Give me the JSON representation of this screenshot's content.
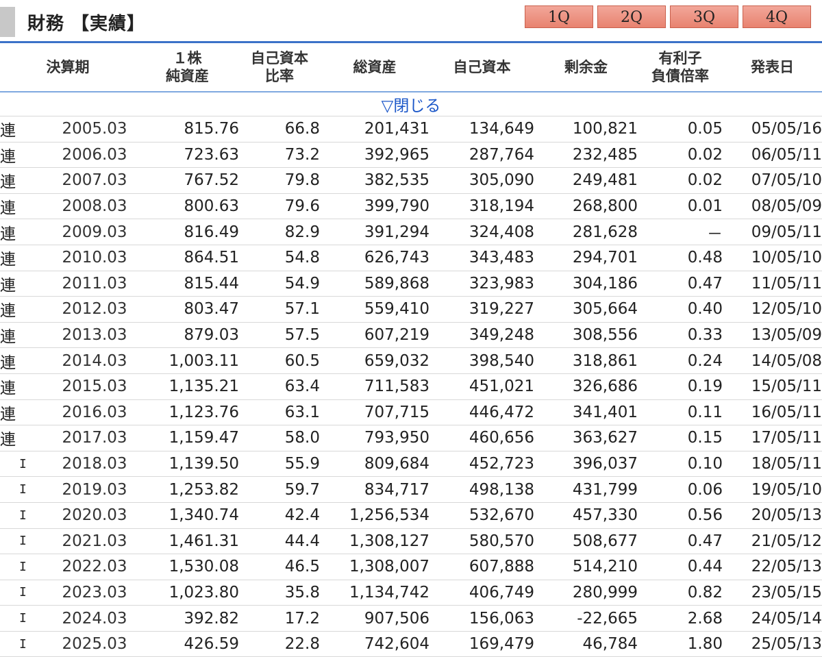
{
  "header": {
    "title": "財務 【実績】",
    "quarter_tabs": [
      "1Q",
      "2Q",
      "3Q",
      "4Q"
    ],
    "accent_color": "#3b72c8",
    "tab_color": "#ee9483"
  },
  "table": {
    "columns": [
      [
        "決算期"
      ],
      [
        "１株",
        "純資産"
      ],
      [
        "自己資本",
        "比率"
      ],
      [
        "総資産"
      ],
      [
        "自己資本"
      ],
      [
        "剰余金"
      ],
      [
        "有利子",
        "負債倍率"
      ],
      [
        "発表日"
      ]
    ],
    "toggle_label": "▽閉じる",
    "rows": [
      {
        "kind": "連",
        "period": "2005.03",
        "bps": "815.76",
        "equity_ratio": "66.8",
        "total_assets": "201,431",
        "equity": "134,649",
        "retained": "100,821",
        "debt_ratio": "0.05",
        "date": "05/05/16"
      },
      {
        "kind": "連",
        "period": "2006.03",
        "bps": "723.63",
        "equity_ratio": "73.2",
        "total_assets": "392,965",
        "equity": "287,764",
        "retained": "232,485",
        "debt_ratio": "0.02",
        "date": "06/05/11"
      },
      {
        "kind": "連",
        "period": "2007.03",
        "bps": "767.52",
        "equity_ratio": "79.8",
        "total_assets": "382,535",
        "equity": "305,090",
        "retained": "249,481",
        "debt_ratio": "0.02",
        "date": "07/05/10"
      },
      {
        "kind": "連",
        "period": "2008.03",
        "bps": "800.63",
        "equity_ratio": "79.6",
        "total_assets": "399,790",
        "equity": "318,194",
        "retained": "268,800",
        "debt_ratio": "0.01",
        "date": "08/05/09"
      },
      {
        "kind": "連",
        "period": "2009.03",
        "bps": "816.49",
        "equity_ratio": "82.9",
        "total_assets": "391,294",
        "equity": "324,408",
        "retained": "281,628",
        "debt_ratio": "－",
        "date": "09/05/11"
      },
      {
        "kind": "連",
        "period": "2010.03",
        "bps": "864.51",
        "equity_ratio": "54.8",
        "total_assets": "626,743",
        "equity": "343,483",
        "retained": "294,701",
        "debt_ratio": "0.48",
        "date": "10/05/10"
      },
      {
        "kind": "連",
        "period": "2011.03",
        "bps": "815.44",
        "equity_ratio": "54.9",
        "total_assets": "589,868",
        "equity": "323,983",
        "retained": "304,186",
        "debt_ratio": "0.47",
        "date": "11/05/11"
      },
      {
        "kind": "連",
        "period": "2012.03",
        "bps": "803.47",
        "equity_ratio": "57.1",
        "total_assets": "559,410",
        "equity": "319,227",
        "retained": "305,664",
        "debt_ratio": "0.40",
        "date": "12/05/10"
      },
      {
        "kind": "連",
        "period": "2013.03",
        "bps": "879.03",
        "equity_ratio": "57.5",
        "total_assets": "607,219",
        "equity": "349,248",
        "retained": "308,556",
        "debt_ratio": "0.33",
        "date": "13/05/09"
      },
      {
        "kind": "連",
        "period": "2014.03",
        "bps": "1,003.11",
        "equity_ratio": "60.5",
        "total_assets": "659,032",
        "equity": "398,540",
        "retained": "318,861",
        "debt_ratio": "0.24",
        "date": "14/05/08"
      },
      {
        "kind": "連",
        "period": "2015.03",
        "bps": "1,135.21",
        "equity_ratio": "63.4",
        "total_assets": "711,583",
        "equity": "451,021",
        "retained": "326,686",
        "debt_ratio": "0.19",
        "date": "15/05/11"
      },
      {
        "kind": "連",
        "period": "2016.03",
        "bps": "1,123.76",
        "equity_ratio": "63.1",
        "total_assets": "707,715",
        "equity": "446,472",
        "retained": "341,401",
        "debt_ratio": "0.11",
        "date": "16/05/11"
      },
      {
        "kind": "連",
        "period": "2017.03",
        "bps": "1,159.47",
        "equity_ratio": "58.0",
        "total_assets": "793,950",
        "equity": "460,656",
        "retained": "363,627",
        "debt_ratio": "0.15",
        "date": "17/05/11"
      },
      {
        "kind": "I",
        "period": "2018.03",
        "bps": "1,139.50",
        "equity_ratio": "55.9",
        "total_assets": "809,684",
        "equity": "452,723",
        "retained": "396,037",
        "debt_ratio": "0.10",
        "date": "18/05/11"
      },
      {
        "kind": "I",
        "period": "2019.03",
        "bps": "1,253.82",
        "equity_ratio": "59.7",
        "total_assets": "834,717",
        "equity": "498,138",
        "retained": "431,799",
        "debt_ratio": "0.06",
        "date": "19/05/10"
      },
      {
        "kind": "I",
        "period": "2020.03",
        "bps": "1,340.74",
        "equity_ratio": "42.4",
        "total_assets": "1,256,534",
        "equity": "532,670",
        "retained": "457,330",
        "debt_ratio": "0.56",
        "date": "20/05/13"
      },
      {
        "kind": "I",
        "period": "2021.03",
        "bps": "1,461.31",
        "equity_ratio": "44.4",
        "total_assets": "1,308,127",
        "equity": "580,570",
        "retained": "508,677",
        "debt_ratio": "0.47",
        "date": "21/05/12"
      },
      {
        "kind": "I",
        "period": "2022.03",
        "bps": "1,530.08",
        "equity_ratio": "46.5",
        "total_assets": "1,308,007",
        "equity": "607,888",
        "retained": "514,210",
        "debt_ratio": "0.44",
        "date": "22/05/13"
      },
      {
        "kind": "I",
        "period": "2023.03",
        "bps": "1,023.80",
        "equity_ratio": "35.8",
        "total_assets": "1,134,742",
        "equity": "406,749",
        "retained": "280,999",
        "debt_ratio": "0.82",
        "date": "23/05/15"
      },
      {
        "kind": "I",
        "period": "2024.03",
        "bps": "392.82",
        "equity_ratio": "17.2",
        "total_assets": "907,506",
        "equity": "156,063",
        "retained": "-22,665",
        "debt_ratio": "2.68",
        "date": "24/05/14"
      },
      {
        "kind": "I",
        "period": "2025.03",
        "bps": "426.59",
        "equity_ratio": "22.8",
        "total_assets": "742,604",
        "equity": "169,479",
        "retained": "46,784",
        "debt_ratio": "1.80",
        "date": "25/05/13"
      }
    ]
  }
}
